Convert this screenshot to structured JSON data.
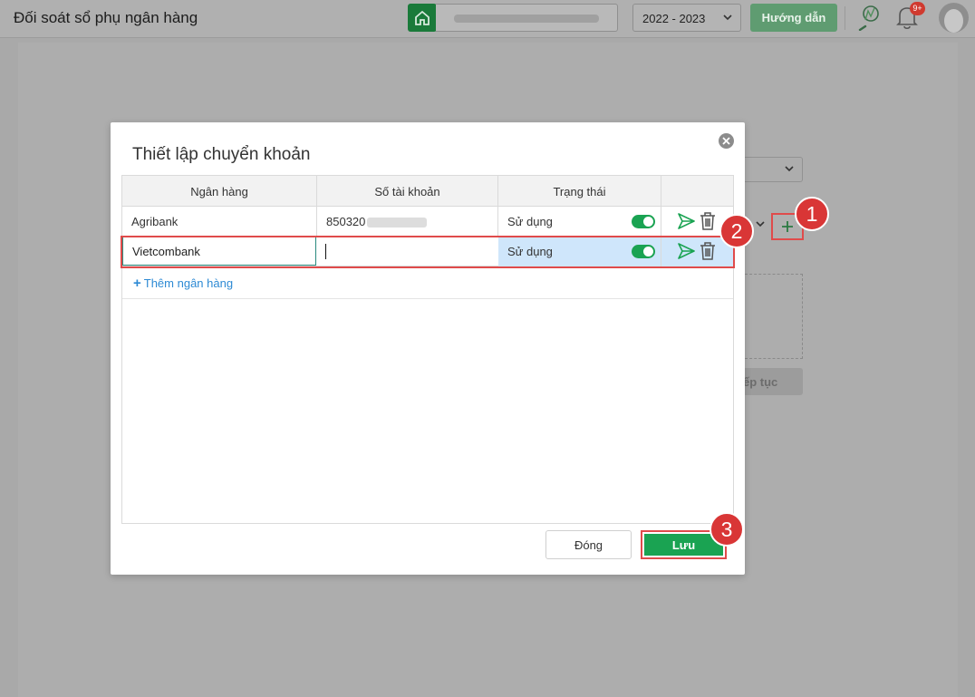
{
  "header": {
    "title": "Đối soát sổ phụ ngân hàng",
    "fiscal_year": "2022 - 2023",
    "guide_label": "Hướng dẫn",
    "notification_badge": "9+"
  },
  "background": {
    "continue_label": "ếp tục"
  },
  "modal": {
    "title": "Thiết lập chuyển khoản",
    "columns": [
      "Ngân hàng",
      "Số tài khoản",
      "Trạng thái"
    ],
    "rows": [
      {
        "bank": "Agribank",
        "account": "850320",
        "status": "Sử dụng",
        "enabled": true
      },
      {
        "bank": "Vietcombank",
        "account": "",
        "status": "Sử dụng",
        "enabled": true
      }
    ],
    "add_bank_label": "Thêm ngân hàng",
    "close_label": "Đóng",
    "save_label": "Lưu"
  },
  "annotations": {
    "step1": "1",
    "step2": "2",
    "step3": "3"
  },
  "colors": {
    "primary_green": "#1aa352",
    "annotation_red": "#e04b4b",
    "link_blue": "#2d8ad4",
    "selected_row": "#cfe6fb"
  }
}
